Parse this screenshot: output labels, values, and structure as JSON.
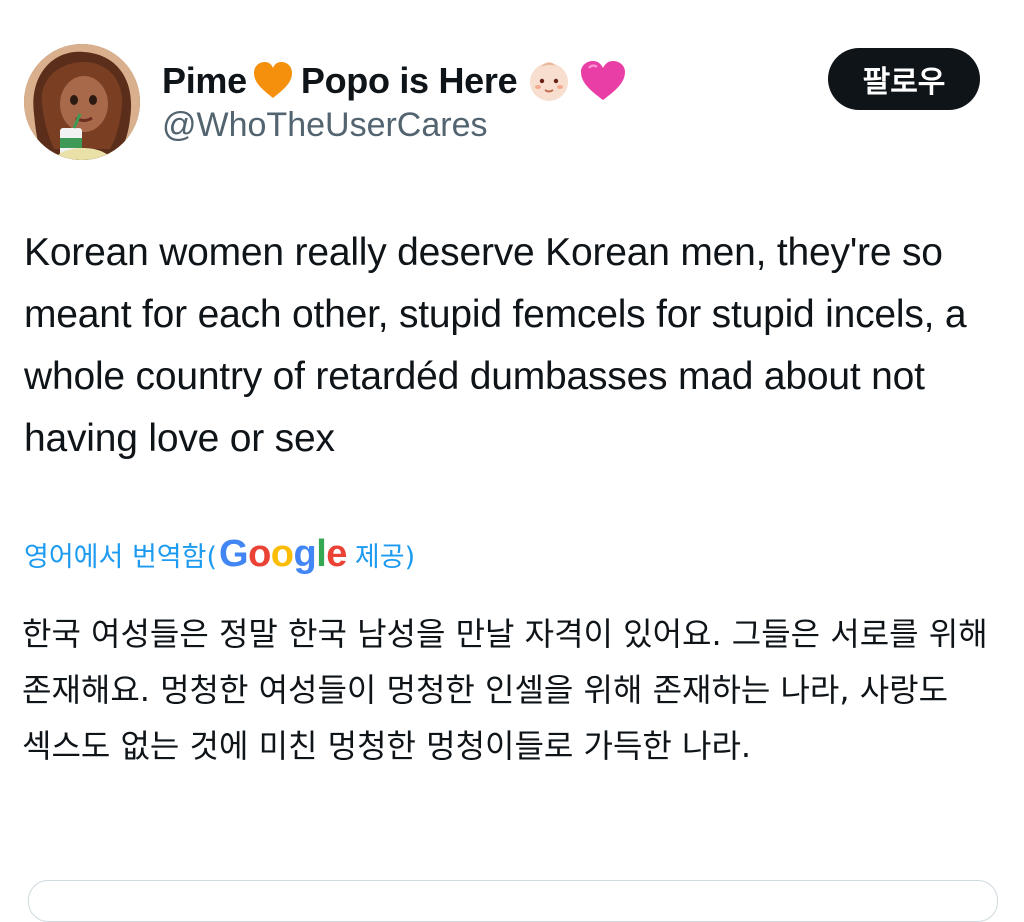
{
  "tweet": {
    "author": {
      "name_part1": "Pime",
      "name_part2": "Popo is Here",
      "handle": "@WhoTheUserCares",
      "name_icons": [
        "orange-heart-icon",
        "baby-face-icon",
        "pink-heart-icon"
      ]
    },
    "follow_label": "팔로우",
    "text": "Korean women really deserve Korean men, they're so meant for each other, stupid femcels for stupid incels, a whole country of retardéd dumbasses mad about not having love or sex",
    "translation": {
      "prefix": "영어에서 번역함(",
      "provider": "Google",
      "suffix": " 제공)",
      "text": "한국 여성들은 정말 한국 남성을 만날 자격이 있어요. 그들은 서로를 위해 존재해요. 멍청한 여성들이 멍청한 인셀을 위해 존재하는 나라, 사랑도 섹스도 없는 것에 미친 멍청한 멍청이들로 가득한 나라."
    }
  },
  "colors": {
    "text_primary": "#0f1419",
    "text_secondary": "#536471",
    "link_blue": "#1d9bf0",
    "button_bg": "#0f1419"
  }
}
